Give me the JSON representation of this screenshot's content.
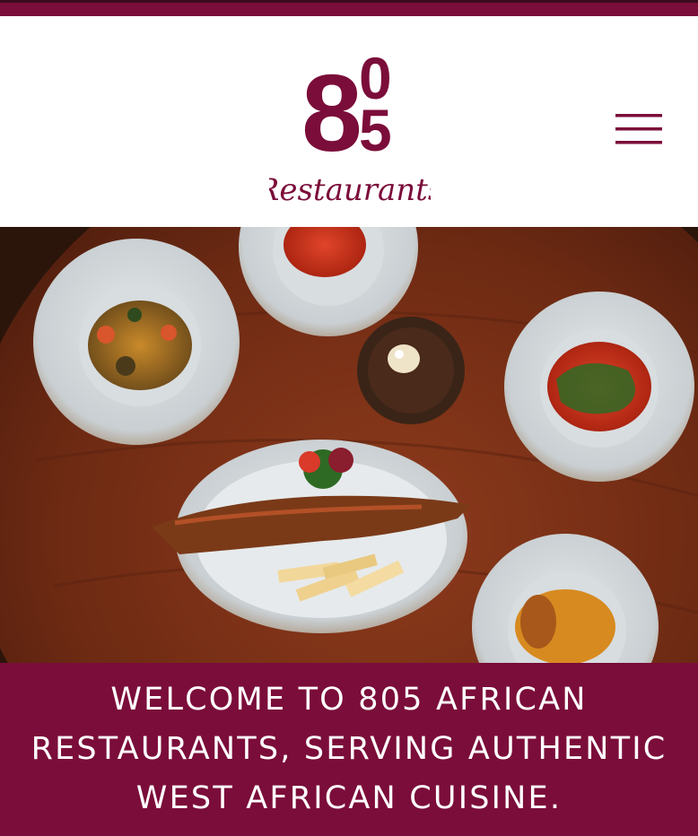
{
  "header": {
    "logo_alt": "805 Restaurants",
    "logo_digits": {
      "big": "8",
      "small_top": "0",
      "small_bottom": "5"
    },
    "logo_script": "Restaurants",
    "menu_icon": "hamburger-menu-icon"
  },
  "hero": {
    "image": "food-spread-photo"
  },
  "welcome": {
    "text": "WELCOME TO 805 AFRICAN RESTAURANTS, SERVING AUTHENTIC WEST AFRICAN CUISINE."
  },
  "colors": {
    "brand": "#7b0d3a",
    "background": "#ffffff",
    "text_on_brand": "#ffffff"
  }
}
